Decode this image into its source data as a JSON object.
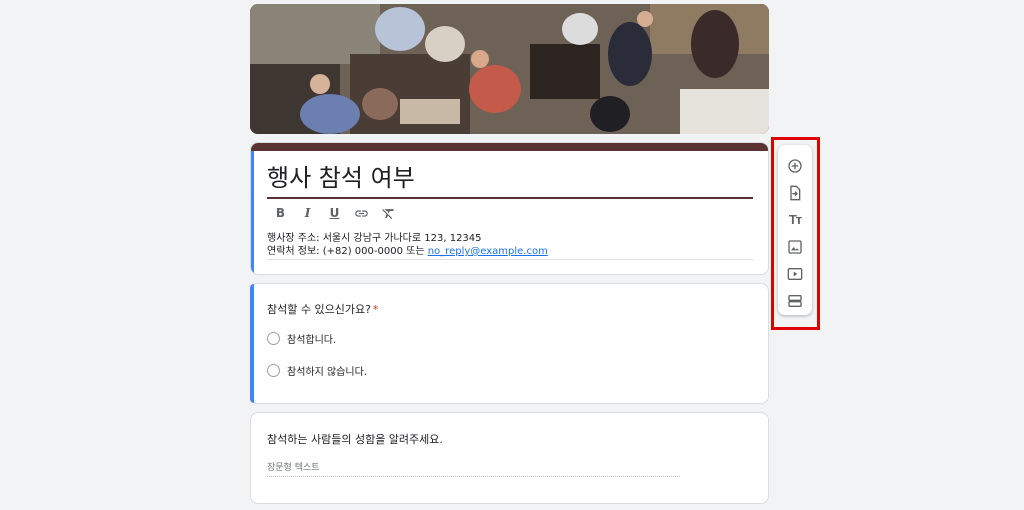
{
  "form": {
    "title": "행사 참석 여부",
    "description_line1": "행사장 주소: 서울시 강남구 가나다로 123, 12345",
    "description_line2_prefix": "연락처 정보: (+82) 000-0000 또는 ",
    "description_email": "no_reply@example.com"
  },
  "formatting": {
    "bold": "B",
    "italic": "I",
    "underline": "U",
    "icons": [
      "bold-icon",
      "italic-icon",
      "underline-icon",
      "link-icon",
      "clear-format-icon"
    ]
  },
  "questions": [
    {
      "title": "참석할 수 있으신가요?",
      "required_mark": "*",
      "options": [
        "참석합니다.",
        "참석하지 않습니다."
      ]
    },
    {
      "title": "참석하는 사람들의 성함을 알려주세요.",
      "answer_placeholder": "장문형 텍스트"
    }
  ],
  "toolbar": {
    "text_icon_label": "Tт",
    "items": [
      "add-question-icon",
      "import-questions-icon",
      "add-title-icon",
      "add-image-icon",
      "add-video-icon",
      "add-section-icon"
    ]
  },
  "colors": {
    "theme": "#5a3432",
    "accent": "#4285f4",
    "highlight": "#e00000",
    "link": "#1a73e8"
  }
}
